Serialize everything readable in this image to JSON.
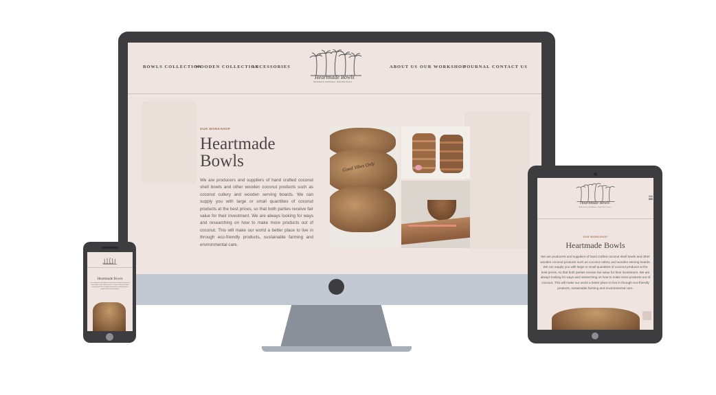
{
  "desktop": {
    "nav_left": [
      "BOWLS COLLECTION",
      "WOODEN COLLECTION",
      "ACCESSORIES"
    ],
    "nav_right": [
      "ABOUT US",
      "OUR WORKSHOP",
      "JOURNAL",
      "CONTACT US"
    ],
    "logo_text": "Heartmade Bowls",
    "logo_sub": "Handcrafted by Local Artisans · Sugar Palm Coconut",
    "eyebrow": "OUR WORKSHOP",
    "hero_line1": "Heartmade",
    "hero_line2": "Bowls",
    "paragraph": "We are producers and suppliers of hand crafted coconut shell bowls and other wooden coconut products such as coconut cutlery and wooden serving boards. We can supply you with large or small quantities of coconut products at the best prices, so that both parties receive fair value for their investment. We are always looking for ways and researching on how to make more products out of coconut. This will make our world a better place to live in through eco-friendly products, sustainable farming and environmental care.",
    "bowl_engraving": "Good Vibes Only"
  },
  "tablet": {
    "logo_text": "Heartmade Bowls",
    "logo_sub": "Handcrafted by Local Artisans · Sugar Palm Coconut",
    "eyebrow": "OUR WORKSHOP",
    "title": "Heartmade Bowls",
    "paragraph": "We are producers and suppliers of hand crafted coconut shell bowls and other wooden coconut products such as coconut cutlery and wooden serving boards. We can supply you with large or small quantities of coconut products at the best prices, so that both parties receive fair value for their investment. We are always looking for ways and researching on how to make more products out of coconut. This will make our world a better place to live in through eco-friendly products, sustainable farming and environmental care."
  },
  "phone": {
    "logo_text": "Heartmade Bowls",
    "title": "Heartmade Bowls",
    "paragraph": "We are producers and suppliers of hand crafted coconut shell bowls and other wooden coconut products such as coconut cutlery and wooden serving boards. We can supply you with large or small quantities of coconut products at the best prices."
  },
  "colors": {
    "frame": "#3d3d3f",
    "screen_bg": "#efe4df",
    "chin": "#c3c9d2",
    "text_dark": "#4a4648",
    "accent": "#9c6e52"
  },
  "icons": [
    "palm-tree-icon",
    "hamburger-menu-icon",
    "camera-icon",
    "home-button-icon"
  ]
}
